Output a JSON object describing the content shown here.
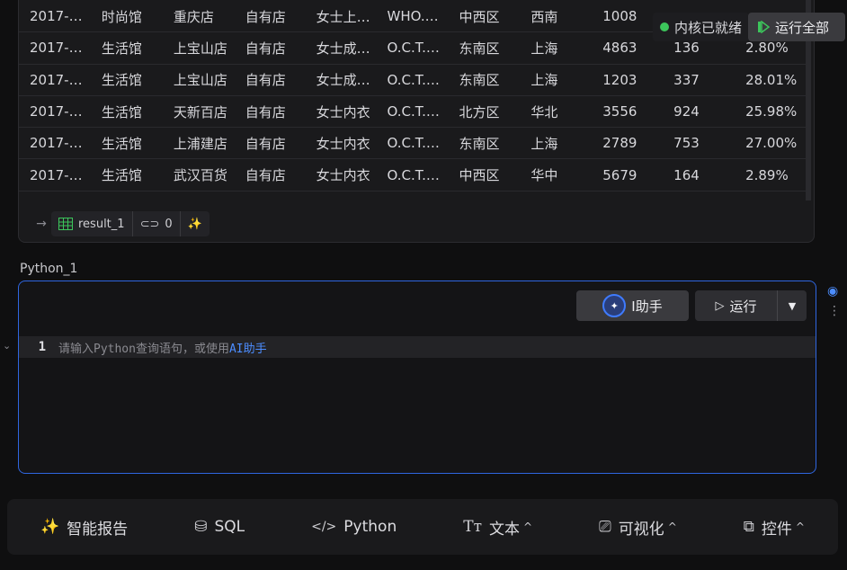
{
  "table": {
    "rows": [
      [
        "2017-…",
        "时尚馆",
        "重庆店",
        "自有店",
        "女士上…",
        "WHO.…",
        "中西区",
        "西南",
        "1008",
        "",
        ""
      ],
      [
        "2017-…",
        "生活馆",
        "上宝山店",
        "自有店",
        "女士成…",
        "O.C.T.…",
        "东南区",
        "上海",
        "4863",
        "136",
        "2.80%"
      ],
      [
        "2017-…",
        "生活馆",
        "上宝山店",
        "自有店",
        "女士成…",
        "O.C.T.…",
        "东南区",
        "上海",
        "1203",
        "337",
        "28.01%"
      ],
      [
        "2017-…",
        "生活馆",
        "天新百店",
        "自有店",
        "女士内衣",
        "O.C.T.…",
        "北方区",
        "华北",
        "3556",
        "924",
        "25.98%"
      ],
      [
        "2017-…",
        "生活馆",
        "上浦建店",
        "自有店",
        "女士内衣",
        "O.C.T.…",
        "东南区",
        "上海",
        "2789",
        "753",
        "27.00%"
      ],
      [
        "2017-…",
        "生活馆",
        "武汉百货",
        "自有店",
        "女士内衣",
        "O.C.T.…",
        "中西区",
        "华中",
        "5679",
        "164",
        "2.89%"
      ]
    ],
    "result_name": "result_1",
    "link_count": "0"
  },
  "kernel": {
    "status": "内核已就绪",
    "run_all": "运行全部"
  },
  "python_cell": {
    "title": "Python_1",
    "ai_label": "I助手",
    "run_label": "运行",
    "line_number": "1",
    "placeholder": "请输入Python查询语句，或使用",
    "placeholder_link": "AI助手"
  },
  "toolbar": {
    "report": "智能报告",
    "sql": "SQL",
    "python": "Python",
    "text": "文本",
    "viz": "可视化",
    "widget": "控件"
  },
  "colors": {
    "accent": "#2f66e0",
    "kernel_ok": "#3cc55b",
    "run_green": "#3cc55b"
  }
}
